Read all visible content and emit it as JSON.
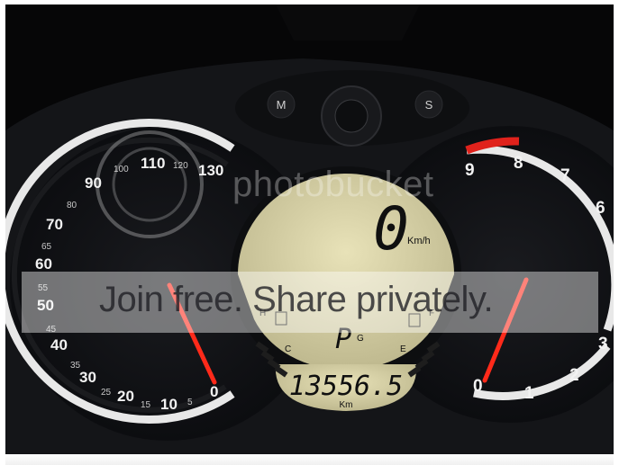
{
  "image": {
    "description_visible": "Motorcycle dashboard instrument cluster photo"
  },
  "cluster": {
    "buttons": {
      "mode": "M",
      "set": "S"
    },
    "speedometer": {
      "major_labels": [
        "0",
        "10",
        "20",
        "30",
        "40",
        "50",
        "60",
        "70",
        "90",
        "110",
        "130"
      ],
      "minor_labels": [
        "5",
        "15",
        "25",
        "35",
        "45",
        "55",
        "65",
        "80",
        "100",
        "120"
      ]
    },
    "tachometer": {
      "labels": [
        "0",
        "1",
        "2",
        "3",
        "6",
        "7",
        "8",
        "9"
      ]
    },
    "lcd": {
      "speed_value": "0",
      "speed_unit": "Km/h",
      "gear": "P",
      "gear_sub": "G",
      "odometer_value": "13556.5",
      "odometer_unit": "Km",
      "temp_letters": {
        "cold": "C",
        "hot": "H"
      },
      "fuel_letters": {
        "empty": "E",
        "full": "F"
      }
    }
  },
  "watermark": {
    "brand": "photobucket",
    "tagline": "Join free. Share privately."
  },
  "colors": {
    "needle": "#ff2a1a",
    "lcd_bg": "#d9d3a8",
    "lcd_text": "#101010",
    "redline": "#e0221c"
  }
}
